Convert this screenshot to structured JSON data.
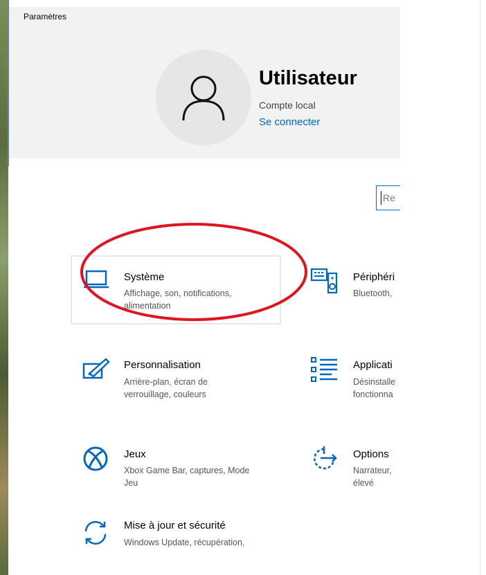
{
  "window": {
    "title": "Paramètres"
  },
  "user": {
    "name": "Utilisateur",
    "account_type": "Compte local",
    "sign_in_label": "Se connecter"
  },
  "search": {
    "placeholder": "Re"
  },
  "categories": [
    {
      "icon": "laptop-icon",
      "title": "Système",
      "desc_line1": "Affichage, son, notifications,",
      "desc_line2": "alimentation"
    },
    {
      "icon": "keyboard-speaker-icon",
      "title": "Périphéri",
      "desc_line1": "Bluetooth,",
      "desc_line2": ""
    },
    {
      "icon": "paint-brush-icon",
      "title": "Personnalisation",
      "desc_line1": "Arrière-plan, écran de",
      "desc_line2": "verrouillage, couleurs"
    },
    {
      "icon": "apps-list-icon",
      "title": "Applicati",
      "desc_line1": "Désinstalle",
      "desc_line2": "fonctionna"
    },
    {
      "icon": "xbox-icon",
      "title": "Jeux",
      "desc_line1": "Xbox Game Bar, captures, Mode",
      "desc_line2": "Jeu"
    },
    {
      "icon": "ease-of-access-icon",
      "title": "Options",
      "desc_line1": "Narrateur,",
      "desc_line2": "élevé"
    },
    {
      "icon": "update-sync-icon",
      "title": "Mise à jour et sécurité",
      "desc_line1": "Windows Update, récupération,",
      "desc_line2": ""
    }
  ],
  "colors": {
    "accent": "#0067c0",
    "annotation": "#e0141e",
    "header_bg": "#f2f2f2"
  }
}
